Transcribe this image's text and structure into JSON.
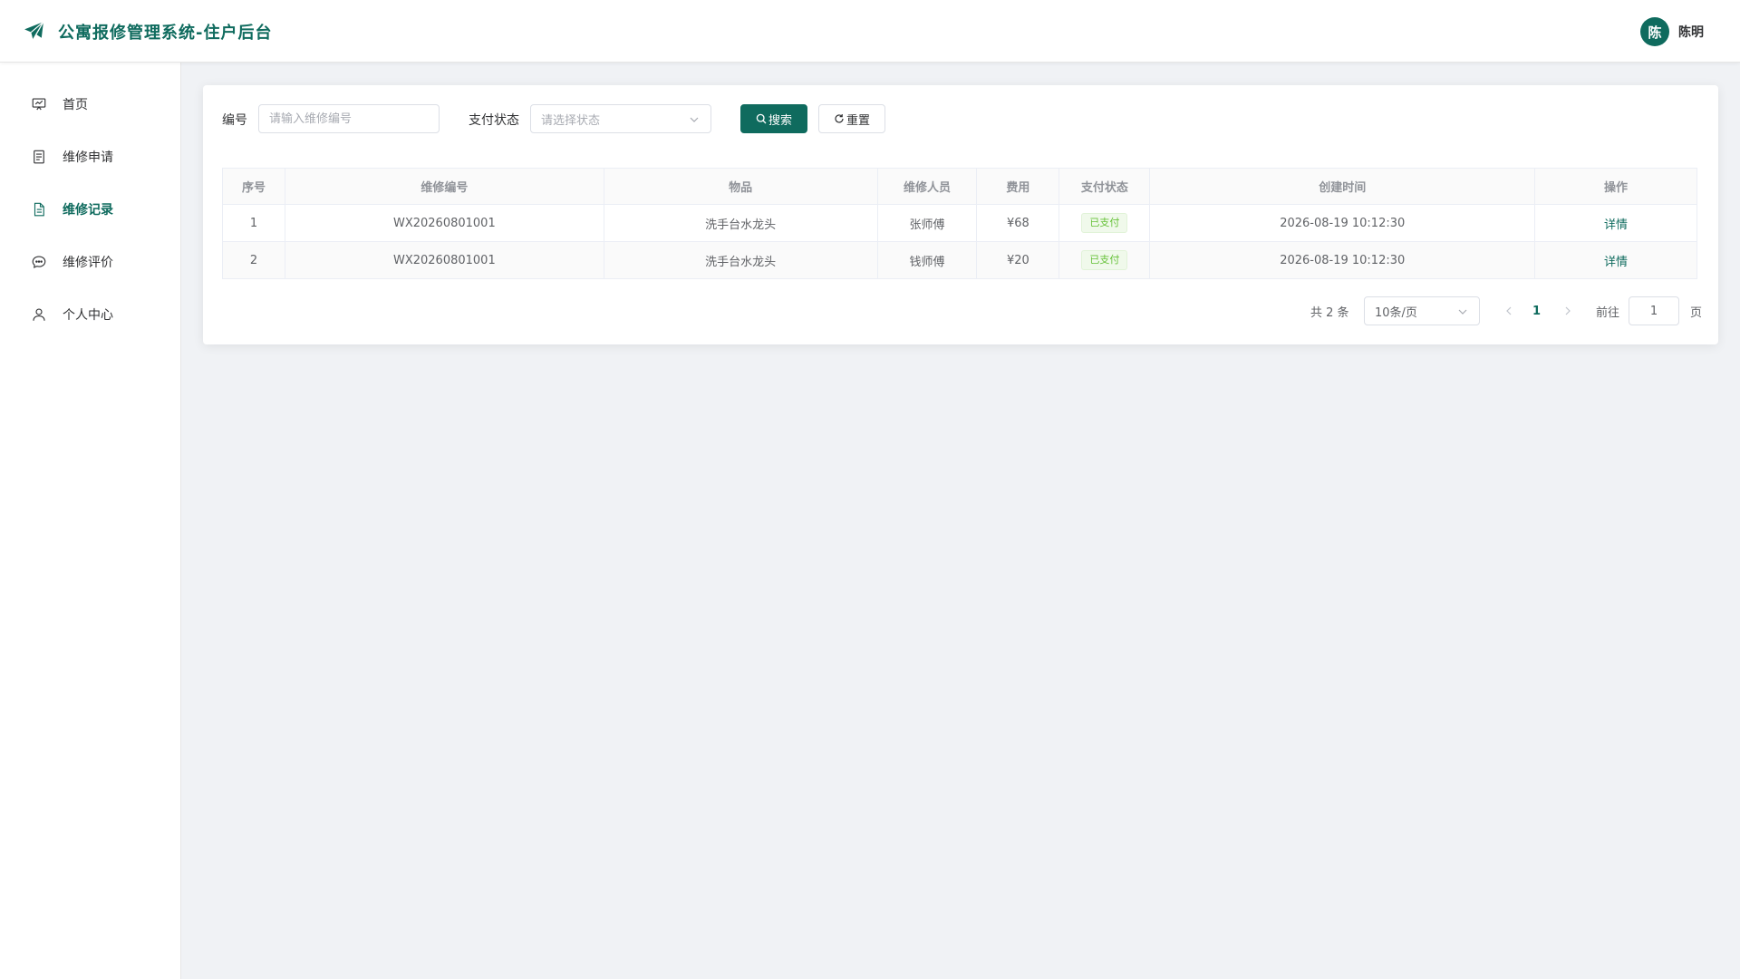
{
  "header": {
    "title": "公寓报修管理系统-住户后台",
    "avatar_text": "陈",
    "user_name": "陈明"
  },
  "sidebar": {
    "items": [
      {
        "label": "首页",
        "icon": "presentation-chart-icon"
      },
      {
        "label": "维修申请",
        "icon": "document-icon"
      },
      {
        "label": "维修记录",
        "icon": "document-list-icon",
        "active": true
      },
      {
        "label": "维修评价",
        "icon": "chat-bubble-icon"
      },
      {
        "label": "个人中心",
        "icon": "user-icon"
      }
    ]
  },
  "filters": {
    "code_label": "编号",
    "code_placeholder": "请输入维修编号",
    "status_label": "支付状态",
    "status_placeholder": "请选择状态",
    "search_label": "搜索",
    "reset_label": "重置"
  },
  "table": {
    "columns": [
      "序号",
      "维修编号",
      "物品",
      "维修人员",
      "费用",
      "支付状态",
      "创建时间",
      "操作"
    ],
    "rows": [
      {
        "index": "1",
        "code": "WX20260801001",
        "item": "洗手台水龙头",
        "worker": "张师傅",
        "fee": "¥68",
        "status": "已支付",
        "created": "2026-08-19 10:12:30",
        "action": "详情"
      },
      {
        "index": "2",
        "code": "WX20260801001",
        "item": "洗手台水龙头",
        "worker": "钱师傅",
        "fee": "¥20",
        "status": "已支付",
        "created": "2026-08-19 10:12:30",
        "action": "详情"
      }
    ]
  },
  "pagination": {
    "total_text": "共 2 条",
    "page_size": "10条/页",
    "current_page": "1",
    "goto_label": "前往",
    "goto_value": "1",
    "page_suffix": "页"
  },
  "colors": {
    "primary": "#0f6b5e",
    "success": "#67c23a",
    "background": "#f0f2f5"
  }
}
